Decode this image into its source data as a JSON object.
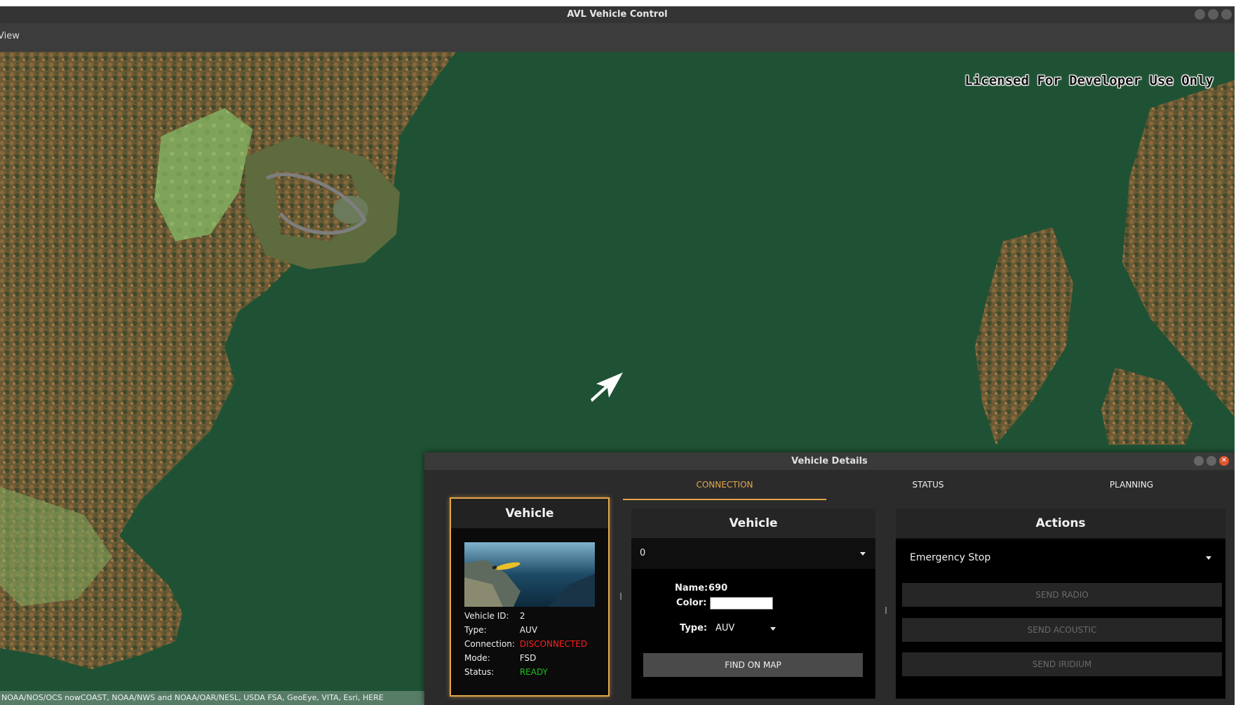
{
  "window": {
    "title": "AVL Vehicle Control"
  },
  "menu": {
    "items": [
      "View"
    ]
  },
  "map": {
    "watermark": "Licensed For Developer Use Only",
    "attribution": "NOAA/NOS/OCS nowCOAST, NOAA/NWS and NOAA/OAR/NESL, USDA FSA, GeoEye, VITA, Esri, HERE"
  },
  "dialog": {
    "title": "Vehicle Details",
    "vehicle_card": {
      "title": "Vehicle",
      "rows": [
        {
          "label": "Vehicle ID:",
          "value": "2"
        },
        {
          "label": "Type:",
          "value": "AUV"
        },
        {
          "label": "Connection:",
          "value": "DISCONNECTED",
          "color": "#ff2020"
        },
        {
          "label": "Mode:",
          "value": "FSD"
        },
        {
          "label": "Status:",
          "value": "READY",
          "color": "#1bbf1b"
        }
      ]
    },
    "tabs": [
      {
        "label": "CONNECTION",
        "active": true
      },
      {
        "label": "STATUS",
        "active": false
      },
      {
        "label": "PLANNING",
        "active": false
      }
    ],
    "vehicle_panel": {
      "title": "Vehicle",
      "selected": "0",
      "name_label": "Name:",
      "name_value": "690",
      "color_label": "Color:",
      "color_value": "#ffffff",
      "type_label": "Type:",
      "type_value": "AUV",
      "find_button": "FIND ON MAP"
    },
    "actions_panel": {
      "title": "Actions",
      "selected_action": "Emergency Stop",
      "buttons": [
        "SEND RADIO",
        "SEND ACOUSTIC",
        "SEND IRIDIUM"
      ]
    }
  },
  "colors": {
    "accent": "#e5a74a",
    "disconnected": "#ff2020",
    "ready": "#1bbf1b"
  }
}
